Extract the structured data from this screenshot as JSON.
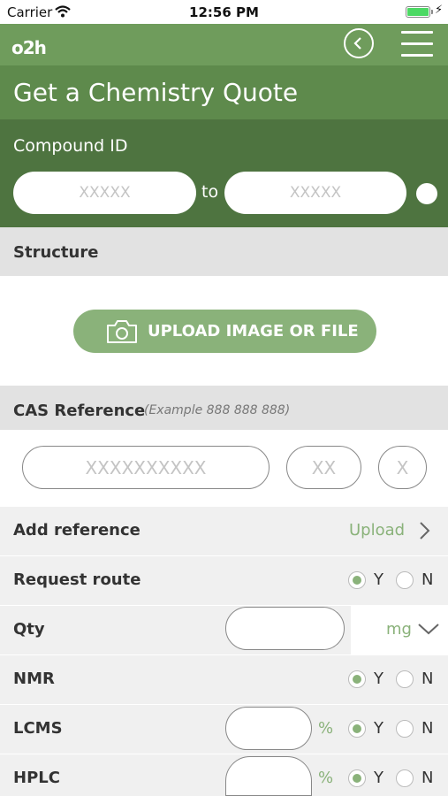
{
  "status_bar": {
    "carrier": "Carrier",
    "time": "12:56 PM"
  },
  "header": {
    "logo": "o2h"
  },
  "page": {
    "title": "Get a Chemistry Quote",
    "compound_id": {
      "label": "Compound ID",
      "from_placeholder": "XXXXX",
      "to_label": "to",
      "to_placeholder": "XXXXX"
    }
  },
  "structure": {
    "label": "Structure",
    "upload_label": "UPLOAD IMAGE OR FILE"
  },
  "cas": {
    "label": "CAS Reference",
    "example": "(Example 888 888 888)",
    "part1_placeholder": "XXXXXXXXXX",
    "part2_placeholder": "XX",
    "part3_placeholder": "X"
  },
  "rows": {
    "add_reference": {
      "label": "Add reference",
      "action": "Upload"
    },
    "request_route": {
      "label": "Request route",
      "yes": "Y",
      "no": "N",
      "selected": "Y"
    },
    "qty": {
      "label": "Qty",
      "value": "",
      "unit": "mg"
    },
    "nmr": {
      "label": "NMR",
      "yes": "Y",
      "no": "N",
      "selected": "Y"
    },
    "lcms": {
      "label": "LCMS",
      "value": "",
      "unit": "%",
      "yes": "Y",
      "no": "N",
      "selected": "Y"
    },
    "hplc": {
      "label": "HPLC",
      "value": "",
      "unit": "%",
      "yes": "Y",
      "no": "N",
      "selected": "Y"
    }
  },
  "colors": {
    "header": "#6f9c5c",
    "title_band": "#5e8a4c",
    "id_band": "#4e7440",
    "accent": "#8ab27a"
  },
  "icons": [
    "wifi-icon",
    "battery-icon",
    "back-icon",
    "menu-icon",
    "camera-icon",
    "chevron-right-icon",
    "chevron-down-icon"
  ]
}
